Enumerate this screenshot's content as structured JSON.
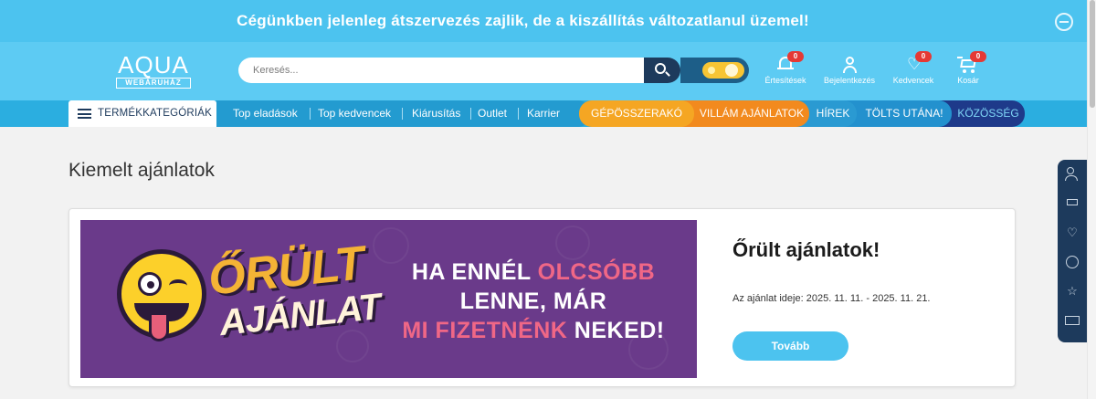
{
  "announcement": {
    "text": "Cégünkben jelenleg átszervezés zajlik, de a kiszállítás változatlanul üzemel!",
    "close_icon": "minus-circle-icon"
  },
  "header": {
    "logo_main": "AQUA",
    "logo_sub": "WEBÁRUHÁZ",
    "search_placeholder": "Keresés...",
    "search_icon": "search-icon",
    "theme_toggle": "theme-toggle",
    "actions": [
      {
        "label": "Értesítések",
        "badge": "0",
        "icon": "bell-icon"
      },
      {
        "label": "Bejelentkezés",
        "icon": "user-icon"
      },
      {
        "label": "Kedvencek",
        "badge": "0",
        "icon": "heart-icon"
      },
      {
        "label": "Kosár",
        "badge": "0",
        "icon": "cart-icon"
      }
    ]
  },
  "nav": {
    "category_button": "TERMÉKKATEGÓRIÁK",
    "links": [
      "Top eladások",
      "Top kedvencek",
      "Kiárusítás",
      "Outlet",
      "Karrier"
    ],
    "pills": [
      "GÉPÖSSZERAKÓ",
      "VILLÁM AJÁNLATOK",
      "HÍREK",
      "TÖLTS UTÁNA!",
      "KÖZÖSSÉG"
    ]
  },
  "main": {
    "section_title": "Kiemelt ajánlatok",
    "banner": {
      "brand_line1": "ŐRÜLT",
      "brand_line2": "AJÁNLAT",
      "headline_1a": "HA ENNÉL ",
      "headline_1b": "OLCSÓBB",
      "headline_2": "LENNE, MÁR",
      "headline_3a": "MI FIZETNÉNK",
      "headline_3b": " NEKED!"
    },
    "offer": {
      "title": "Őrült ajánlatok!",
      "date": "Az ajánlat ideje: 2025. 11. 11. - 2025. 11. 21.",
      "button": "Tovább"
    }
  },
  "side_dock": [
    "user-icon",
    "cart-icon",
    "heart-icon",
    "alarm-clock-icon",
    "star-icon",
    "money-icon"
  ],
  "colors": {
    "announcement_bg": "#4cc3ef",
    "header_bg": "#5dcbf3",
    "nav_bg": "#2baee0",
    "brand_dark": "#1d3a5c",
    "orange": "#f5a623",
    "banner_purple": "#6a3a8a",
    "badge_red": "#e53935"
  }
}
